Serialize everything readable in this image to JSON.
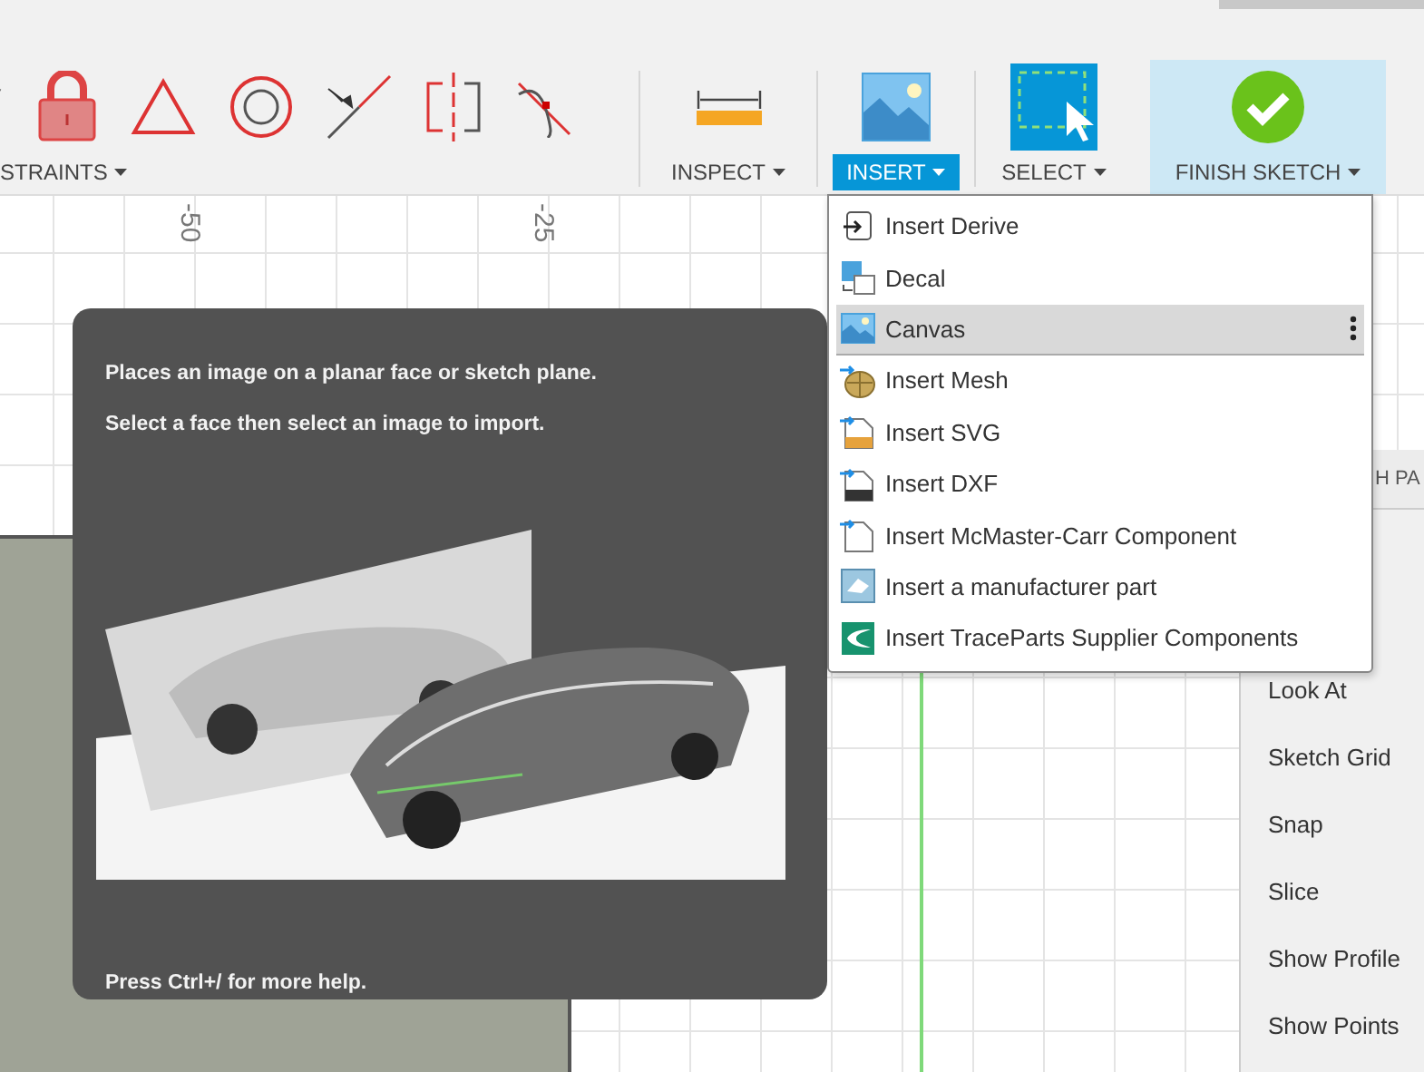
{
  "toolbar": {
    "groups": [
      {
        "kind": "constraints",
        "label": "STRAINTS",
        "selected": false
      },
      {
        "kind": "inspect",
        "label": "INSPECT",
        "selected": false
      },
      {
        "kind": "insert",
        "label": "INSERT",
        "selected": true
      },
      {
        "kind": "select",
        "label": "SELECT",
        "selected": false
      },
      {
        "kind": "finish",
        "label": "FINISH SKETCH",
        "selected": false
      }
    ]
  },
  "canvas": {
    "axis_labels": [
      "-50",
      "-25"
    ]
  },
  "insert_menu": {
    "items": [
      {
        "kind": "derive",
        "label": "Insert Derive",
        "selected": false
      },
      {
        "kind": "decal",
        "label": "Decal",
        "selected": false
      },
      {
        "kind": "canvas",
        "label": "Canvas",
        "selected": true
      },
      {
        "kind": "mesh",
        "label": "Insert Mesh",
        "selected": false
      },
      {
        "kind": "svg",
        "label": "Insert SVG",
        "selected": false
      },
      {
        "kind": "dxf",
        "label": "Insert DXF",
        "selected": false
      },
      {
        "kind": "mcmaster",
        "label": "Insert McMaster-Carr Component",
        "selected": false
      },
      {
        "kind": "manufacturer",
        "label": "Insert a manufacturer part",
        "selected": false
      },
      {
        "kind": "traceparts",
        "label": "Insert TraceParts Supplier Components",
        "selected": false
      }
    ]
  },
  "tooltip": {
    "lines": [
      "Places an image on a planar face or sketch plane.",
      "Select a face then select an image to import."
    ],
    "footer": "Press Ctrl+/ for more help."
  },
  "sketch_palette": {
    "header": "H PA",
    "items": [
      "Look At",
      "Sketch Grid",
      "Snap",
      "Slice",
      "Show Profile",
      "Show Points"
    ]
  }
}
